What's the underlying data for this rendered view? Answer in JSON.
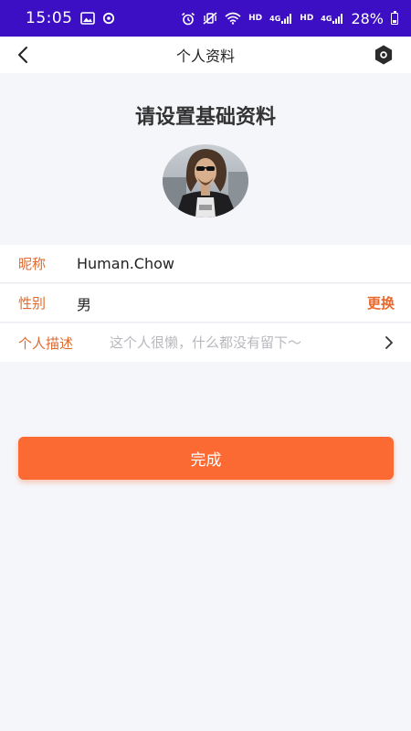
{
  "status_bar": {
    "time": "15:05",
    "hd1": "HD",
    "net1": "4G",
    "hd2": "HD",
    "net2": "4G",
    "battery": "28%"
  },
  "nav": {
    "title": "个人资料",
    "back_icon": "chevron-left-icon",
    "settings_icon": "hexagon-settings-icon"
  },
  "profile": {
    "heading": "请设置基础资料"
  },
  "form": {
    "nickname": {
      "label": "昵称",
      "value": "Human.Chow"
    },
    "gender": {
      "label": "性别",
      "value": "男",
      "action": "更换"
    },
    "description": {
      "label": "个人描述",
      "placeholder": "这个人很懒，什么都没有留下～"
    }
  },
  "actions": {
    "done_label": "完成"
  },
  "colors": {
    "status_bar": "#3d0fc4",
    "accent": "#fb6a33",
    "label": "#e06a2e",
    "background": "#f5f6fa"
  }
}
